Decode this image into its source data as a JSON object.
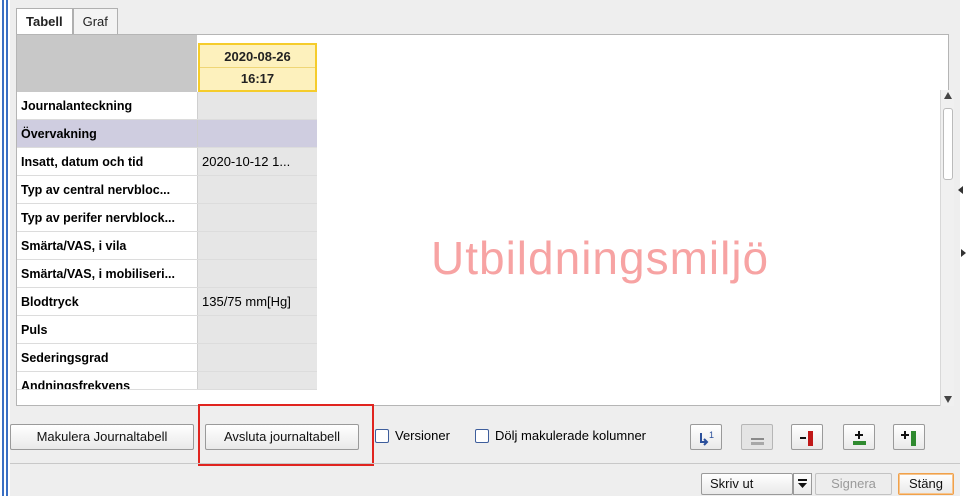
{
  "tabs": [
    {
      "label": "Tabell",
      "active": true
    },
    {
      "label": "Graf",
      "active": false
    }
  ],
  "table": {
    "column_header": {
      "date": "2020-08-26",
      "time": "16:17"
    },
    "rows": [
      {
        "label": "Journalanteckning",
        "value": "",
        "group": false
      },
      {
        "label": "Övervakning",
        "value": "",
        "group": true
      },
      {
        "label": "Insatt, datum och tid",
        "value": "2020-10-12 1...",
        "group": false
      },
      {
        "label": "Typ av central nervbloc...",
        "value": "",
        "group": false
      },
      {
        "label": "Typ av perifer nervblock...",
        "value": "",
        "group": false
      },
      {
        "label": "Smärta/VAS, i vila",
        "value": "",
        "group": false
      },
      {
        "label": "Smärta/VAS, i mobiliseri...",
        "value": "",
        "group": false
      },
      {
        "label": "Blodtryck",
        "value": "135/75 mm[Hg]",
        "group": false
      },
      {
        "label": "Puls",
        "value": "",
        "group": false
      },
      {
        "label": "Sederingsgrad",
        "value": "",
        "group": false
      },
      {
        "label": "Andningsfrekvens",
        "value": "",
        "group": false
      }
    ]
  },
  "watermark": "Utbildningsmiljö",
  "actions": {
    "makulera_label": "Makulera Journaltabell",
    "avsluta_label": "Avsluta journaltabell",
    "versioner_label": "Versioner",
    "dolj_label": "Dölj makulerade kolumner"
  },
  "footer": {
    "skriv_ut_label": "Skriv ut",
    "signera_label": "Signera",
    "stang_label": "Stäng"
  },
  "colors": {
    "highlight_box": "#e0241f",
    "watermark": "#f7a3a3",
    "date_header_bg": "#fdf1bd",
    "date_header_border": "#f5cc2b",
    "group_row_bg": "#cfcde0"
  },
  "icons": {
    "insert_version": "insert-version-icon",
    "remove_column": "remove-column-icon",
    "add_column_right": "add-column-right-icon",
    "add_row": "add-row-icon",
    "add_column": "add-column-icon"
  }
}
